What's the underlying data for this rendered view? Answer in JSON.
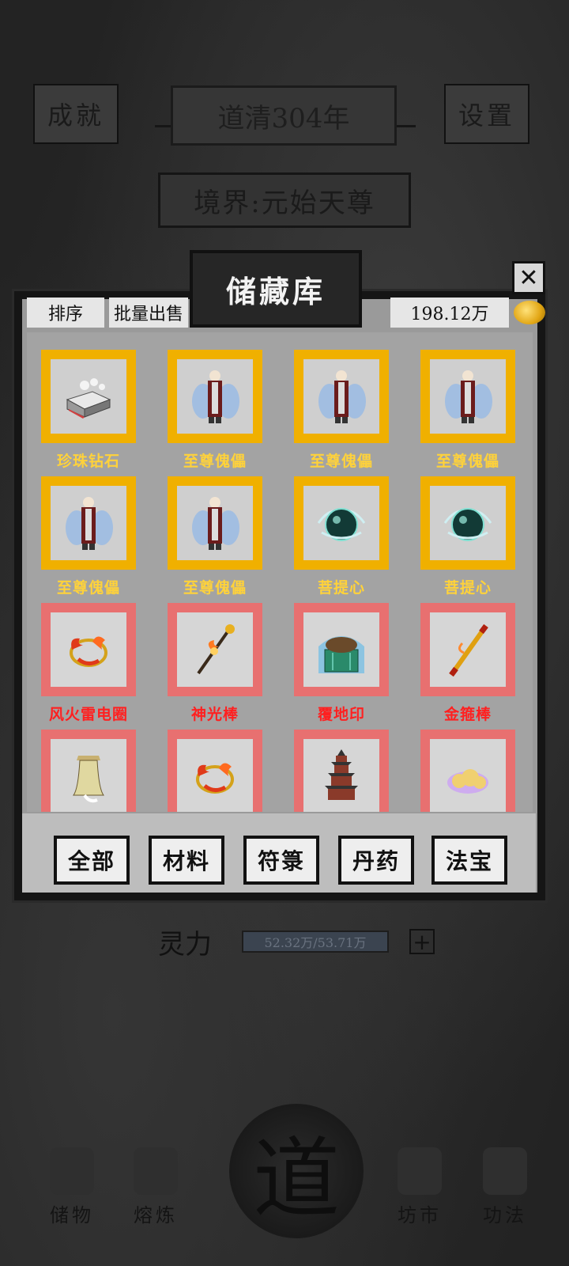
{
  "header": {
    "achievements_label": "成就",
    "year_label": "道清304年",
    "settings_label": "设置",
    "realm_label": "境界:元始天尊"
  },
  "storage": {
    "title": "储藏库",
    "sort_label": "排序",
    "batch_sell_label": "批量出售",
    "currency_amount": "198.12万",
    "items": [
      {
        "name": "珍珠钻石",
        "rarity": "gold",
        "icon": "diamond-crate-icon"
      },
      {
        "name": "至尊傀儡",
        "rarity": "gold",
        "icon": "puppet-icon"
      },
      {
        "name": "至尊傀儡",
        "rarity": "gold",
        "icon": "puppet-icon"
      },
      {
        "name": "至尊傀儡",
        "rarity": "gold",
        "icon": "puppet-icon"
      },
      {
        "name": "至尊傀儡",
        "rarity": "gold",
        "icon": "puppet-icon"
      },
      {
        "name": "至尊傀儡",
        "rarity": "gold",
        "icon": "puppet-icon"
      },
      {
        "name": "菩提心",
        "rarity": "gold",
        "icon": "orb-icon"
      },
      {
        "name": "菩提心",
        "rarity": "gold",
        "icon": "orb-icon"
      },
      {
        "name": "风火雷电圈",
        "rarity": "red",
        "icon": "fire-ring-icon"
      },
      {
        "name": "神光棒",
        "rarity": "red",
        "icon": "staff-icon"
      },
      {
        "name": "覆地印",
        "rarity": "red",
        "icon": "turtle-seal-icon"
      },
      {
        "name": "金箍棒",
        "rarity": "red",
        "icon": "golden-rod-icon"
      },
      {
        "name": "",
        "rarity": "red",
        "icon": "bell-icon"
      },
      {
        "name": "",
        "rarity": "red",
        "icon": "fire-ring-icon"
      },
      {
        "name": "",
        "rarity": "red",
        "icon": "pagoda-icon"
      },
      {
        "name": "",
        "rarity": "red",
        "icon": "cloud-icon"
      }
    ],
    "filters": [
      "全部",
      "材料",
      "符箓",
      "丹药",
      "法宝"
    ]
  },
  "status": {
    "spirit_label": "灵力",
    "spirit_value": "52.32万/53.71万"
  },
  "nav": {
    "center_label": "道",
    "items": [
      "储物",
      "熔炼",
      "坊市",
      "功法"
    ]
  },
  "colors": {
    "gold_frame": "#f0b000",
    "red_frame": "#e87070",
    "gold_text": "#ffd23a",
    "red_text": "#ff2020"
  }
}
